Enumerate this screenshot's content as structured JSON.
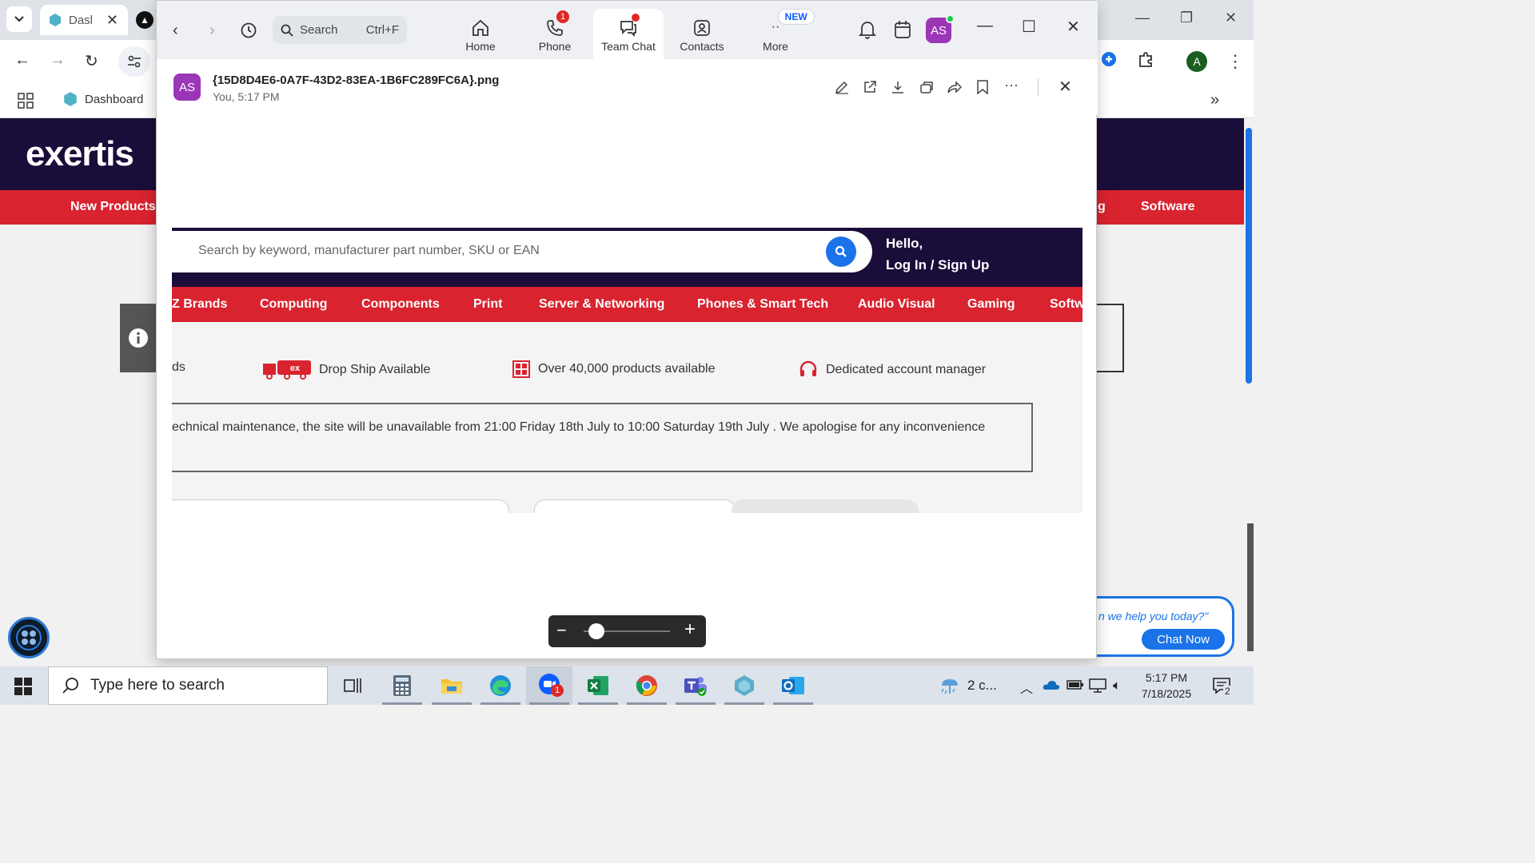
{
  "browser": {
    "tab_title": "Dasl",
    "bookmark": "Dashboard",
    "profile_initial": "A"
  },
  "site": {
    "logo": "exertis",
    "nav_left": "New Products",
    "nav_right_partial": "g",
    "nav_right": "Software",
    "chat_prompt": "n we help you today?\"",
    "chat_button": "Chat Now"
  },
  "zoom": {
    "search_placeholder": "Search",
    "search_shortcut": "Ctrl+F",
    "tabs": [
      {
        "label": "Home"
      },
      {
        "label": "Phone",
        "badge": "1"
      },
      {
        "label": "Team Chat"
      },
      {
        "label": "Contacts"
      },
      {
        "label": "More",
        "badge": "NEW"
      }
    ],
    "avatar": "AS",
    "file": {
      "avatar": "AS",
      "name": "{15D8D4E6-0A7F-43D2-83EA-1B6FC289FC6A}.png",
      "meta": "You, 5:17 PM"
    }
  },
  "embedded": {
    "search_placeholder": "Search by keyword, manufacturer part number, SKU or EAN",
    "hello": "Hello,",
    "login": "Log In / Sign Up",
    "nav": [
      "Z Brands",
      "Computing",
      "Components",
      "Print",
      "Server & Networking",
      "Phones & Smart Tech",
      "Audio Visual",
      "Gaming",
      "Softw"
    ],
    "usps": [
      {
        "text": "ds"
      },
      {
        "text": "Drop Ship Available"
      },
      {
        "text": "Over 40,000 products available"
      },
      {
        "text": "Dedicated account manager"
      }
    ],
    "notice": "echnical maintenance, the site will be unavailable from 21:00 Friday 18th July to 10:00 Saturday 19th July . We apologise for any inconvenience"
  },
  "taskbar": {
    "search_placeholder": "Type here to search",
    "zoom_badge": "1",
    "weather": "2 c...",
    "time": "5:17 PM",
    "date": "7/18/2025",
    "notification_count": "2"
  },
  "colors": {
    "brand_navy": "#1b0d3a",
    "brand_red": "#d9232f",
    "zoom_blue": "#0b5cff",
    "avatar_purple": "#9b36b7"
  }
}
